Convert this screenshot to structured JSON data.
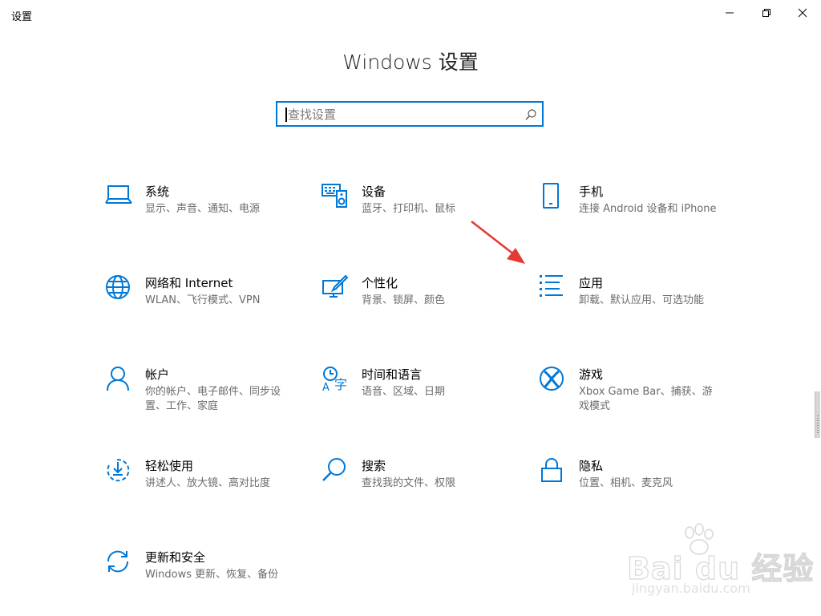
{
  "window": {
    "title": "设置",
    "minimize_icon": "minimize-icon",
    "maximize_icon": "restore-icon",
    "close_icon": "close-icon"
  },
  "header": {
    "title": "Windows 设置"
  },
  "search": {
    "placeholder": "查找设置",
    "value": ""
  },
  "colors": {
    "accent": "#0078d7",
    "arrow": "#e53935",
    "text_secondary": "#6b6b6b"
  },
  "tiles": [
    {
      "name": "系统",
      "desc": "显示、声音、通知、电源",
      "icon": "laptop-icon"
    },
    {
      "name": "设备",
      "desc": "蓝牙、打印机、鼠标",
      "icon": "keyboard-speaker-icon"
    },
    {
      "name": "手机",
      "desc": "连接 Android 设备和 iPhone",
      "icon": "phone-icon"
    },
    {
      "name": "网络和 Internet",
      "desc": "WLAN、飞行模式、VPN",
      "icon": "globe-icon"
    },
    {
      "name": "个性化",
      "desc": "背景、锁屏、颜色",
      "icon": "paint-monitor-icon"
    },
    {
      "name": "应用",
      "desc": "卸载、默认应用、可选功能",
      "icon": "apps-list-icon"
    },
    {
      "name": "帐户",
      "desc": "你的帐户、电子邮件、同步设置、工作、家庭",
      "icon": "person-icon"
    },
    {
      "name": "时间和语言",
      "desc": "语音、区域、日期",
      "icon": "time-language-icon"
    },
    {
      "name": "游戏",
      "desc": "Xbox Game Bar、捕获、游戏模式",
      "icon": "xbox-icon"
    },
    {
      "name": "轻松使用",
      "desc": "讲述人、放大镜、高对比度",
      "icon": "ease-of-access-icon"
    },
    {
      "name": "搜索",
      "desc": "查找我的文件、权限",
      "icon": "search-icon"
    },
    {
      "name": "隐私",
      "desc": "位置、相机、麦克风",
      "icon": "lock-icon"
    },
    {
      "name": "更新和安全",
      "desc": "Windows 更新、恢复、备份",
      "icon": "sync-icon"
    }
  ],
  "watermark": {
    "main": "Bai du 经验",
    "sub": "jingyan.baidu.com"
  }
}
